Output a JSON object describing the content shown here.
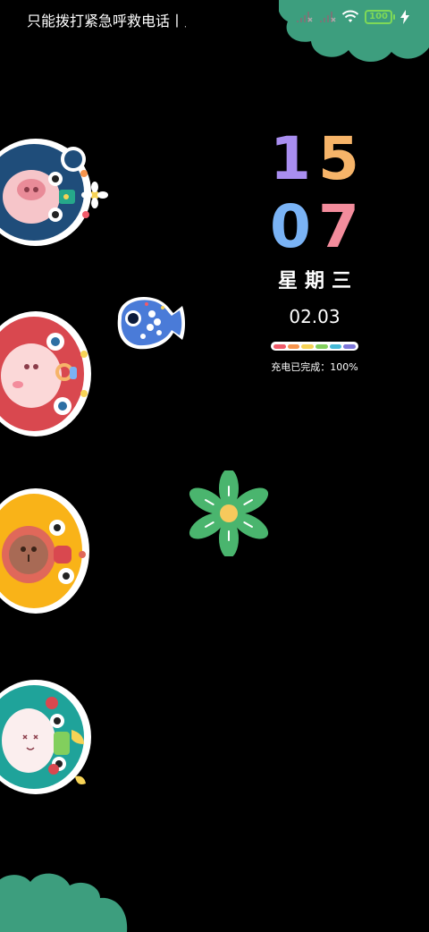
{
  "status_bar": {
    "carrier_text": "只能拨打紧急呼救电话丨只",
    "battery_level": "100",
    "icons": [
      "signal-x-icon",
      "signal-x-icon",
      "wifi-icon",
      "battery-icon",
      "charging-bolt-icon"
    ]
  },
  "clock": {
    "hour_tens": "1",
    "hour_ones": "5",
    "minute_tens": "0",
    "minute_ones": "7",
    "weekday": "星期三",
    "date": "02.03",
    "charge_label": "充电已完成：100%",
    "charge_fraction": 1.0
  },
  "colors": {
    "digit_1": "#a98ef0",
    "digit_5": "#f6b469",
    "digit_0": "#7ab3f5",
    "digit_7": "#f38c9c",
    "cloud": "#3d9e7e",
    "charge_segments": [
      "#f15b6a",
      "#f7944c",
      "#f7d356",
      "#82cf5d",
      "#46b9d6",
      "#7d77d9"
    ]
  },
  "decorations": [
    "blue-dragon-sticker",
    "red-dragon-sticker",
    "yellow-dragon-sticker",
    "teal-dragon-sticker",
    "blue-fish-sticker",
    "green-flower-sticker",
    "green-cloud"
  ]
}
